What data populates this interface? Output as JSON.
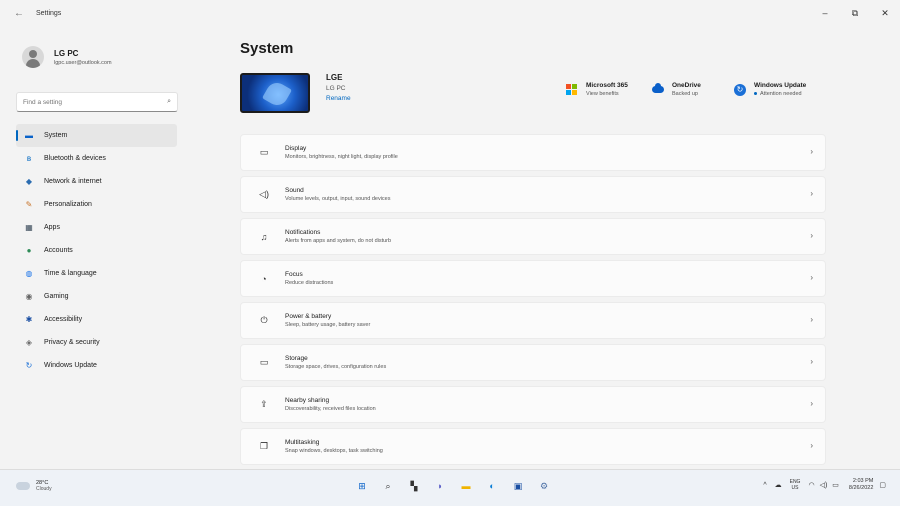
{
  "window": {
    "title": "Settings",
    "back_glyph": "←",
    "minimize_glyph": "–",
    "maximize_glyph": "⧉",
    "close_glyph": "✕"
  },
  "profile": {
    "name": "LG PC",
    "email": "lgpc.user@outlook.com"
  },
  "search": {
    "placeholder": "Find a setting",
    "icon": "search-icon",
    "glyph": "⌕"
  },
  "sidebar": {
    "items": [
      {
        "label": "System",
        "icon": "system-icon",
        "glyph": "▬",
        "color": "#0a63c9"
      },
      {
        "label": "Bluetooth & devices",
        "icon": "bluetooth-icon",
        "glyph": "ʙ",
        "color": "#0067c0"
      },
      {
        "label": "Network & internet",
        "icon": "wifi-icon",
        "glyph": "◆",
        "color": "#2b6cb0"
      },
      {
        "label": "Personalization",
        "icon": "brush-icon",
        "glyph": "✎",
        "color": "#c8742a"
      },
      {
        "label": "Apps",
        "icon": "apps-icon",
        "glyph": "▦",
        "color": "#3a4a5a"
      },
      {
        "label": "Accounts",
        "icon": "accounts-icon",
        "glyph": "●",
        "color": "#2e8b57"
      },
      {
        "label": "Time & language",
        "icon": "globe-icon",
        "glyph": "◍",
        "color": "#1a73e8"
      },
      {
        "label": "Gaming",
        "icon": "gamepad-icon",
        "glyph": "◉",
        "color": "#666666"
      },
      {
        "label": "Accessibility",
        "icon": "accessibility-icon",
        "glyph": "✱",
        "color": "#1a4fa3"
      },
      {
        "label": "Privacy & security",
        "icon": "shield-icon",
        "glyph": "◈",
        "color": "#6b6b6b"
      },
      {
        "label": "Windows Update",
        "icon": "windows-update-icon",
        "glyph": "↻",
        "color": "#1a6fd6"
      }
    ]
  },
  "main": {
    "title": "System",
    "device": {
      "name": "LGE",
      "model": "LG PC",
      "rename_label": "Rename"
    },
    "quick": [
      {
        "title": "Microsoft 365",
        "subtitle": "View benefits",
        "icon": "microsoft-365-icon"
      },
      {
        "title": "OneDrive",
        "subtitle": "Backed up",
        "icon": "onedrive-icon"
      },
      {
        "title": "Windows Update",
        "subtitle": "Attention needed",
        "icon": "windows-update-icon",
        "glyph": "↻"
      }
    ],
    "ms365_colors": [
      "#f25022",
      "#7fba00",
      "#00a4ef",
      "#ffb900"
    ],
    "cards": [
      {
        "title": "Display",
        "subtitle": "Monitors, brightness, night light, display profile",
        "icon": "display-icon",
        "glyph": "▭"
      },
      {
        "title": "Sound",
        "subtitle": "Volume levels, output, input, sound devices",
        "icon": "speaker-icon",
        "glyph": "◁)"
      },
      {
        "title": "Notifications",
        "subtitle": "Alerts from apps and system, do not disturb",
        "icon": "bell-icon",
        "glyph": "♫"
      },
      {
        "title": "Focus",
        "subtitle": "Reduce distractions",
        "icon": "focus-icon",
        "glyph": "◔"
      },
      {
        "title": "Power & battery",
        "subtitle": "Sleep, battery usage, battery saver",
        "icon": "power-icon",
        "glyph": "⏻"
      },
      {
        "title": "Storage",
        "subtitle": "Storage space, drives, configuration rules",
        "icon": "storage-icon",
        "glyph": "▭"
      },
      {
        "title": "Nearby sharing",
        "subtitle": "Discoverability, received files location",
        "icon": "share-icon",
        "glyph": "⇪"
      },
      {
        "title": "Multitasking",
        "subtitle": "Snap windows, desktops, task switching",
        "icon": "multitasking-icon",
        "glyph": "❐"
      }
    ],
    "chevron": "›"
  },
  "taskbar": {
    "weather": {
      "temp": "28°C",
      "condition": "Cloudy"
    },
    "apps": [
      {
        "icon": "start-icon",
        "glyph": "⊞",
        "color": "#0a63c9"
      },
      {
        "icon": "search-icon",
        "glyph": "⌕",
        "color": "#333333"
      },
      {
        "icon": "task-view-icon",
        "glyph": "▚",
        "color": "#333333"
      },
      {
        "icon": "chat-icon",
        "glyph": "◗",
        "color": "#5b5fc7"
      },
      {
        "icon": "file-explorer-icon",
        "glyph": "▬",
        "color": "#f0b400"
      },
      {
        "icon": "edge-icon",
        "glyph": "◐",
        "color": "#0c7fd6"
      },
      {
        "icon": "store-icon",
        "glyph": "▣",
        "color": "#1a4fa3"
      },
      {
        "icon": "settings-icon",
        "glyph": "⚙",
        "color": "#4a6fa5"
      }
    ],
    "tray": {
      "chevron_glyph": "^",
      "onedrive_glyph": "☁",
      "lang_top": "ENG",
      "lang_bottom": "US",
      "wifi_glyph": "◠",
      "volume_glyph": "◁)",
      "battery_glyph": "▭",
      "time": "2:03 PM",
      "date": "8/26/2022",
      "notification_glyph": "▢"
    }
  }
}
